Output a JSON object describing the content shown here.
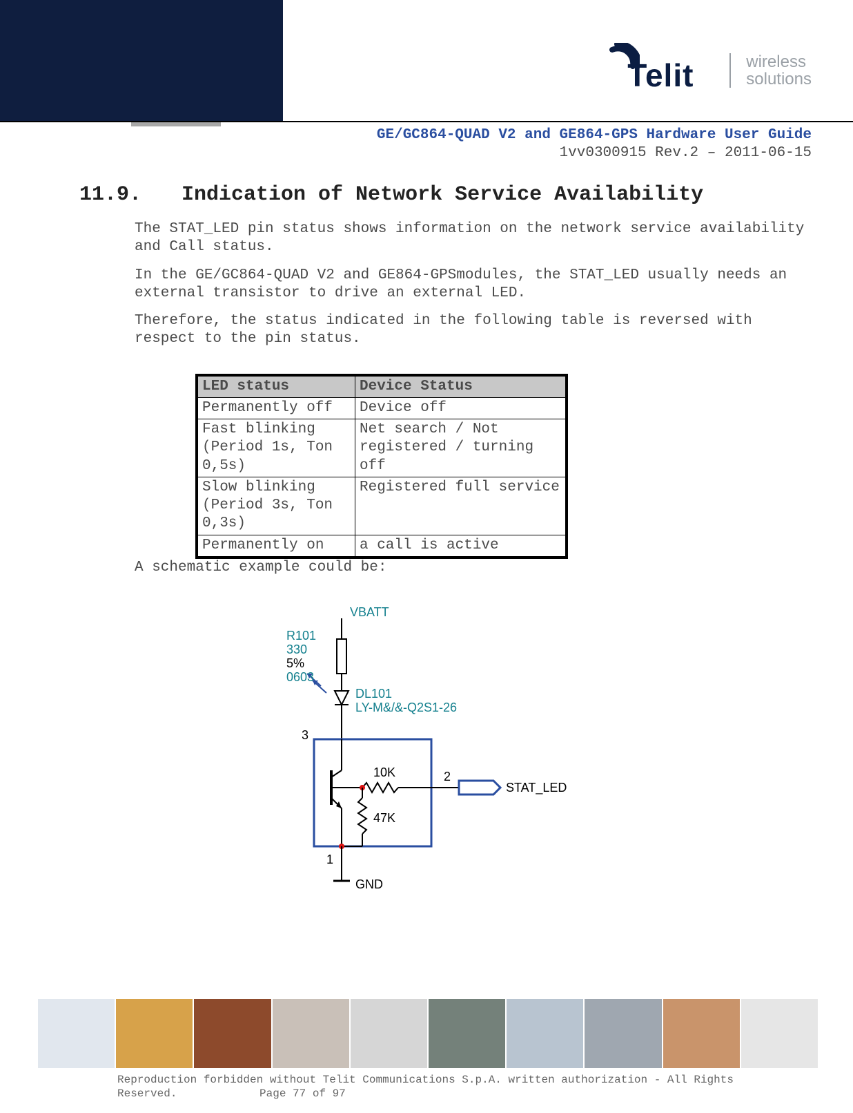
{
  "logo": {
    "word": "Telit",
    "tag_line1": "wireless",
    "tag_line2": "solutions"
  },
  "runhead": {
    "title": "GE/GC864-QUAD V2 and GE864-GPS Hardware User Guide",
    "rev": "1vv0300915 Rev.2 – 2011-06-15"
  },
  "section": {
    "num": "11.9.",
    "title": "Indication of Network Service Availability"
  },
  "paras": {
    "p1": "The STAT_LED pin status shows information on the network service availability and Call status.",
    "p2": "In the GE/GC864-QUAD V2 and GE864-GPSmodules, the STAT_LED usually needs an external transistor to drive an external LED.",
    "p3": "Therefore, the status indicated in the following table is reversed with respect to the pin status.",
    "p4": "A schematic example could be:"
  },
  "table": {
    "headers": [
      "LED status",
      "Device Status"
    ],
    "rows": [
      [
        "Permanently off",
        "Device off"
      ],
      [
        "Fast blinking (Period 1s, Ton 0,5s)",
        "Net search / Not registered / turning off"
      ],
      [
        "Slow blinking (Period 3s, Ton 0,3s)",
        "Registered full service"
      ],
      [
        "Permanently on",
        "a call is active"
      ]
    ]
  },
  "schematic": {
    "vbatt": "VBATT",
    "r_ref": "R101",
    "r_val": "330",
    "r_tol": "5%",
    "r_pkg": "0603",
    "led_ref": "DL101",
    "led_part": "LY-M&/&-Q2S1-26",
    "pin3": "3",
    "r_in": "10K",
    "r_pd": "47K",
    "pin2": "2",
    "signal": "STAT_LED",
    "pin1": "1",
    "gnd": "GND"
  },
  "footer": {
    "notice": "Reproduction forbidden without Telit Communications S.p.A. written authorization - All Rights",
    "reserved": "Reserved.",
    "page": "Page 77 of 97"
  },
  "footer_tile_colors": [
    "#e1e7ee",
    "#d7a24a",
    "#8d4a2c",
    "#c9c0b8",
    "#d6d6d6",
    "#74817a",
    "#b8c4d0",
    "#9fa7b0",
    "#c9946b",
    "#e6e6e6"
  ]
}
